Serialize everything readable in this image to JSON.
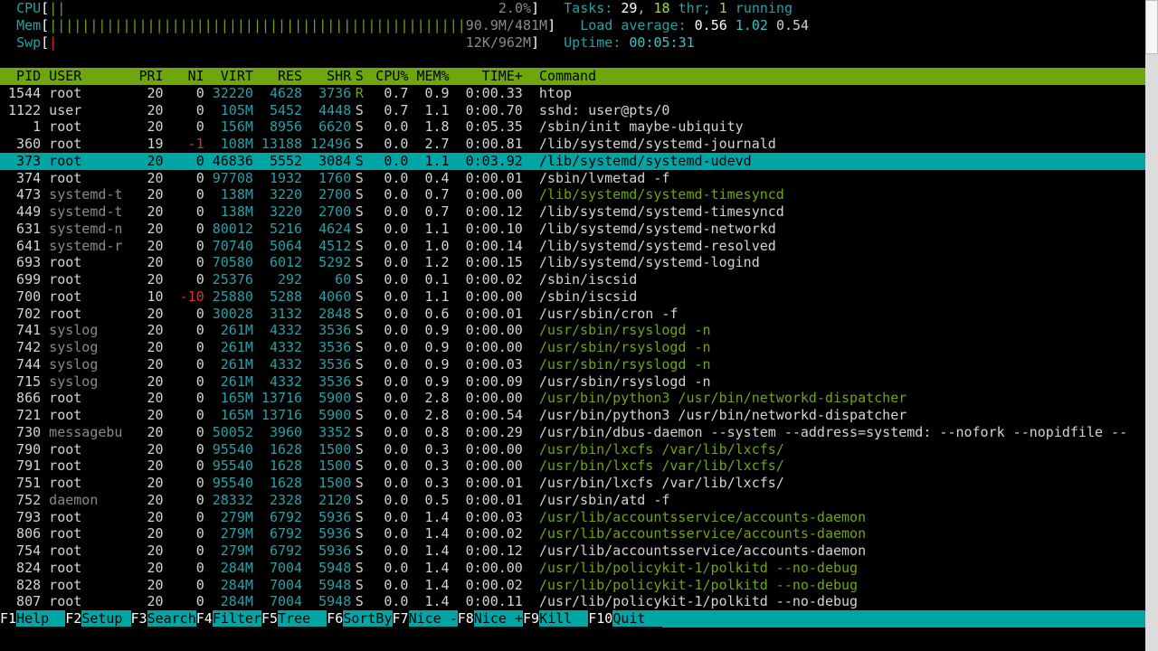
{
  "meters": {
    "cpu": {
      "label": "CPU",
      "bar": "||",
      "pct": "2.0%"
    },
    "mem": {
      "label": "Mem",
      "bar": "|||||||||||||||||||||||||||||||||||||||||||||||||||",
      "used": "90.9M",
      "total": "481M"
    },
    "swp": {
      "label": "Swp",
      "bar": "|",
      "used": "12K",
      "total": "962M"
    },
    "tasks": {
      "label": "Tasks:",
      "total": "29",
      "threads": "18",
      "thr": "thr;",
      "running": "1",
      "running_label": "running"
    },
    "load": {
      "label": "Load average:",
      "a": "0.56",
      "b": "1.02",
      "c": "0.54"
    },
    "uptime": {
      "label": "Uptime:",
      "value": "00:05:31"
    }
  },
  "header": {
    "pid": "PID",
    "user": "USER",
    "pri": "PRI",
    "ni": "NI",
    "virt": "VIRT",
    "res": "RES",
    "shr": "SHR",
    "s": "S",
    "cpu": "CPU%",
    "mem": "MEM%",
    "time": "TIME+",
    "cmd": "Command"
  },
  "rows": [
    {
      "pid": "1544",
      "user": "root",
      "pri": "20",
      "ni": "0",
      "virt": "32220",
      "res": "4628",
      "shr": "3736",
      "s": "R",
      "cpu": "0.7",
      "mem": "0.9",
      "time": "0:00.33",
      "cmd": "htop",
      "hl": false
    },
    {
      "pid": "1122",
      "user": "user",
      "pri": "20",
      "ni": "0",
      "virt": "105M",
      "res": "5452",
      "shr": "4448",
      "s": "S",
      "cpu": "0.7",
      "mem": "1.1",
      "time": "0:00.70",
      "cmd": "sshd: user@pts/0",
      "hl": false
    },
    {
      "pid": "1",
      "user": "root",
      "pri": "20",
      "ni": "0",
      "virt": "156M",
      "res": "8956",
      "shr": "6620",
      "s": "S",
      "cpu": "0.0",
      "mem": "1.8",
      "time": "0:05.35",
      "cmd": "/sbin/init maybe-ubiquity",
      "hl": false
    },
    {
      "pid": "360",
      "user": "root",
      "pri": "19",
      "ni": "-1",
      "virt": "108M",
      "res": "13188",
      "shr": "12496",
      "s": "S",
      "cpu": "0.0",
      "mem": "2.7",
      "time": "0:00.81",
      "cmd": "/lib/systemd/systemd-journald",
      "hl": false
    },
    {
      "pid": "373",
      "user": "root",
      "pri": "20",
      "ni": "0",
      "virt": "46836",
      "res": "5552",
      "shr": "3084",
      "s": "S",
      "cpu": "0.0",
      "mem": "1.1",
      "time": "0:03.92",
      "cmd": "/lib/systemd/systemd-udevd",
      "hl": true
    },
    {
      "pid": "374",
      "user": "root",
      "pri": "20",
      "ni": "0",
      "virt": "97708",
      "res": "1932",
      "shr": "1760",
      "s": "S",
      "cpu": "0.0",
      "mem": "0.4",
      "time": "0:00.01",
      "cmd": "/sbin/lvmetad -f",
      "hl": false
    },
    {
      "pid": "473",
      "user": "systemd-t",
      "pri": "20",
      "ni": "0",
      "virt": "138M",
      "res": "3220",
      "shr": "2700",
      "s": "S",
      "cpu": "0.0",
      "mem": "0.7",
      "time": "0:00.00",
      "cmd": "/lib/systemd/systemd-timesyncd",
      "green": true,
      "hl": false
    },
    {
      "pid": "449",
      "user": "systemd-t",
      "pri": "20",
      "ni": "0",
      "virt": "138M",
      "res": "3220",
      "shr": "2700",
      "s": "S",
      "cpu": "0.0",
      "mem": "0.7",
      "time": "0:00.12",
      "cmd": "/lib/systemd/systemd-timesyncd",
      "hl": false
    },
    {
      "pid": "631",
      "user": "systemd-n",
      "pri": "20",
      "ni": "0",
      "virt": "80012",
      "res": "5216",
      "shr": "4624",
      "s": "S",
      "cpu": "0.0",
      "mem": "1.1",
      "time": "0:00.10",
      "cmd": "/lib/systemd/systemd-networkd",
      "hl": false
    },
    {
      "pid": "641",
      "user": "systemd-r",
      "pri": "20",
      "ni": "0",
      "virt": "70740",
      "res": "5064",
      "shr": "4512",
      "s": "S",
      "cpu": "0.0",
      "mem": "1.0",
      "time": "0:00.14",
      "cmd": "/lib/systemd/systemd-resolved",
      "hl": false
    },
    {
      "pid": "693",
      "user": "root",
      "pri": "20",
      "ni": "0",
      "virt": "70580",
      "res": "6012",
      "shr": "5292",
      "s": "S",
      "cpu": "0.0",
      "mem": "1.2",
      "time": "0:00.15",
      "cmd": "/lib/systemd/systemd-logind",
      "hl": false
    },
    {
      "pid": "699",
      "user": "root",
      "pri": "20",
      "ni": "0",
      "virt": "25376",
      "res": "292",
      "shr": "60",
      "s": "S",
      "cpu": "0.0",
      "mem": "0.1",
      "time": "0:00.02",
      "cmd": "/sbin/iscsid",
      "hl": false
    },
    {
      "pid": "700",
      "user": "root",
      "pri": "10",
      "ni": "-10",
      "virt": "25880",
      "res": "5288",
      "shr": "4060",
      "s": "S",
      "cpu": "0.0",
      "mem": "1.1",
      "time": "0:00.00",
      "cmd": "/sbin/iscsid",
      "hl": false
    },
    {
      "pid": "702",
      "user": "root",
      "pri": "20",
      "ni": "0",
      "virt": "30028",
      "res": "3132",
      "shr": "2848",
      "s": "S",
      "cpu": "0.0",
      "mem": "0.6",
      "time": "0:00.01",
      "cmd": "/usr/sbin/cron -f",
      "hl": false
    },
    {
      "pid": "741",
      "user": "syslog",
      "pri": "20",
      "ni": "0",
      "virt": "261M",
      "res": "4332",
      "shr": "3536",
      "s": "S",
      "cpu": "0.0",
      "mem": "0.9",
      "time": "0:00.00",
      "cmd": "/usr/sbin/rsyslogd -n",
      "green": true,
      "hl": false
    },
    {
      "pid": "742",
      "user": "syslog",
      "pri": "20",
      "ni": "0",
      "virt": "261M",
      "res": "4332",
      "shr": "3536",
      "s": "S",
      "cpu": "0.0",
      "mem": "0.9",
      "time": "0:00.00",
      "cmd": "/usr/sbin/rsyslogd -n",
      "green": true,
      "hl": false
    },
    {
      "pid": "744",
      "user": "syslog",
      "pri": "20",
      "ni": "0",
      "virt": "261M",
      "res": "4332",
      "shr": "3536",
      "s": "S",
      "cpu": "0.0",
      "mem": "0.9",
      "time": "0:00.03",
      "cmd": "/usr/sbin/rsyslogd -n",
      "green": true,
      "hl": false
    },
    {
      "pid": "715",
      "user": "syslog",
      "pri": "20",
      "ni": "0",
      "virt": "261M",
      "res": "4332",
      "shr": "3536",
      "s": "S",
      "cpu": "0.0",
      "mem": "0.9",
      "time": "0:00.09",
      "cmd": "/usr/sbin/rsyslogd -n",
      "hl": false
    },
    {
      "pid": "866",
      "user": "root",
      "pri": "20",
      "ni": "0",
      "virt": "165M",
      "res": "13716",
      "shr": "5900",
      "s": "S",
      "cpu": "0.0",
      "mem": "2.8",
      "time": "0:00.00",
      "cmd": "/usr/bin/python3 /usr/bin/networkd-dispatcher",
      "green": true,
      "hl": false
    },
    {
      "pid": "721",
      "user": "root",
      "pri": "20",
      "ni": "0",
      "virt": "165M",
      "res": "13716",
      "shr": "5900",
      "s": "S",
      "cpu": "0.0",
      "mem": "2.8",
      "time": "0:00.54",
      "cmd": "/usr/bin/python3 /usr/bin/networkd-dispatcher",
      "hl": false
    },
    {
      "pid": "730",
      "user": "messagebu",
      "pri": "20",
      "ni": "0",
      "virt": "50052",
      "res": "3960",
      "shr": "3352",
      "s": "S",
      "cpu": "0.0",
      "mem": "0.8",
      "time": "0:00.29",
      "cmd": "/usr/bin/dbus-daemon --system --address=systemd: --nofork --nopidfile --",
      "hl": false
    },
    {
      "pid": "790",
      "user": "root",
      "pri": "20",
      "ni": "0",
      "virt": "95540",
      "res": "1628",
      "shr": "1500",
      "s": "S",
      "cpu": "0.0",
      "mem": "0.3",
      "time": "0:00.00",
      "cmd": "/usr/bin/lxcfs /var/lib/lxcfs/",
      "green": true,
      "hl": false
    },
    {
      "pid": "791",
      "user": "root",
      "pri": "20",
      "ni": "0",
      "virt": "95540",
      "res": "1628",
      "shr": "1500",
      "s": "S",
      "cpu": "0.0",
      "mem": "0.3",
      "time": "0:00.00",
      "cmd": "/usr/bin/lxcfs /var/lib/lxcfs/",
      "green": true,
      "hl": false
    },
    {
      "pid": "751",
      "user": "root",
      "pri": "20",
      "ni": "0",
      "virt": "95540",
      "res": "1628",
      "shr": "1500",
      "s": "S",
      "cpu": "0.0",
      "mem": "0.3",
      "time": "0:00.01",
      "cmd": "/usr/bin/lxcfs /var/lib/lxcfs/",
      "hl": false
    },
    {
      "pid": "752",
      "user": "daemon",
      "pri": "20",
      "ni": "0",
      "virt": "28332",
      "res": "2328",
      "shr": "2120",
      "s": "S",
      "cpu": "0.0",
      "mem": "0.5",
      "time": "0:00.01",
      "cmd": "/usr/sbin/atd -f",
      "hl": false
    },
    {
      "pid": "793",
      "user": "root",
      "pri": "20",
      "ni": "0",
      "virt": "279M",
      "res": "6792",
      "shr": "5936",
      "s": "S",
      "cpu": "0.0",
      "mem": "1.4",
      "time": "0:00.03",
      "cmd": "/usr/lib/accountsservice/accounts-daemon",
      "green": true,
      "hl": false
    },
    {
      "pid": "806",
      "user": "root",
      "pri": "20",
      "ni": "0",
      "virt": "279M",
      "res": "6792",
      "shr": "5936",
      "s": "S",
      "cpu": "0.0",
      "mem": "1.4",
      "time": "0:00.02",
      "cmd": "/usr/lib/accountsservice/accounts-daemon",
      "green": true,
      "hl": false
    },
    {
      "pid": "754",
      "user": "root",
      "pri": "20",
      "ni": "0",
      "virt": "279M",
      "res": "6792",
      "shr": "5936",
      "s": "S",
      "cpu": "0.0",
      "mem": "1.4",
      "time": "0:00.12",
      "cmd": "/usr/lib/accountsservice/accounts-daemon",
      "hl": false
    },
    {
      "pid": "824",
      "user": "root",
      "pri": "20",
      "ni": "0",
      "virt": "284M",
      "res": "7004",
      "shr": "5948",
      "s": "S",
      "cpu": "0.0",
      "mem": "1.4",
      "time": "0:00.00",
      "cmd": "/usr/lib/policykit-1/polkitd --no-debug",
      "green": true,
      "hl": false
    },
    {
      "pid": "828",
      "user": "root",
      "pri": "20",
      "ni": "0",
      "virt": "284M",
      "res": "7004",
      "shr": "5948",
      "s": "S",
      "cpu": "0.0",
      "mem": "1.4",
      "time": "0:00.02",
      "cmd": "/usr/lib/policykit-1/polkitd --no-debug",
      "green": true,
      "hl": false
    },
    {
      "pid": "807",
      "user": "root",
      "pri": "20",
      "ni": "0",
      "virt": "284M",
      "res": "7004",
      "shr": "5948",
      "s": "S",
      "cpu": "0.0",
      "mem": "1.4",
      "time": "0:00.11",
      "cmd": "/usr/lib/policykit-1/polkitd --no-debug",
      "hl": false
    }
  ],
  "fkeys": [
    {
      "k": "F1",
      "l": "Help  "
    },
    {
      "k": "F2",
      "l": "Setup "
    },
    {
      "k": "F3",
      "l": "Search"
    },
    {
      "k": "F4",
      "l": "Filter"
    },
    {
      "k": "F5",
      "l": "Tree  "
    },
    {
      "k": "F6",
      "l": "SortBy"
    },
    {
      "k": "F7",
      "l": "Nice -"
    },
    {
      "k": "F8",
      "l": "Nice +"
    },
    {
      "k": "F9",
      "l": "Kill  "
    },
    {
      "k": "F10",
      "l": "Quit  "
    }
  ]
}
